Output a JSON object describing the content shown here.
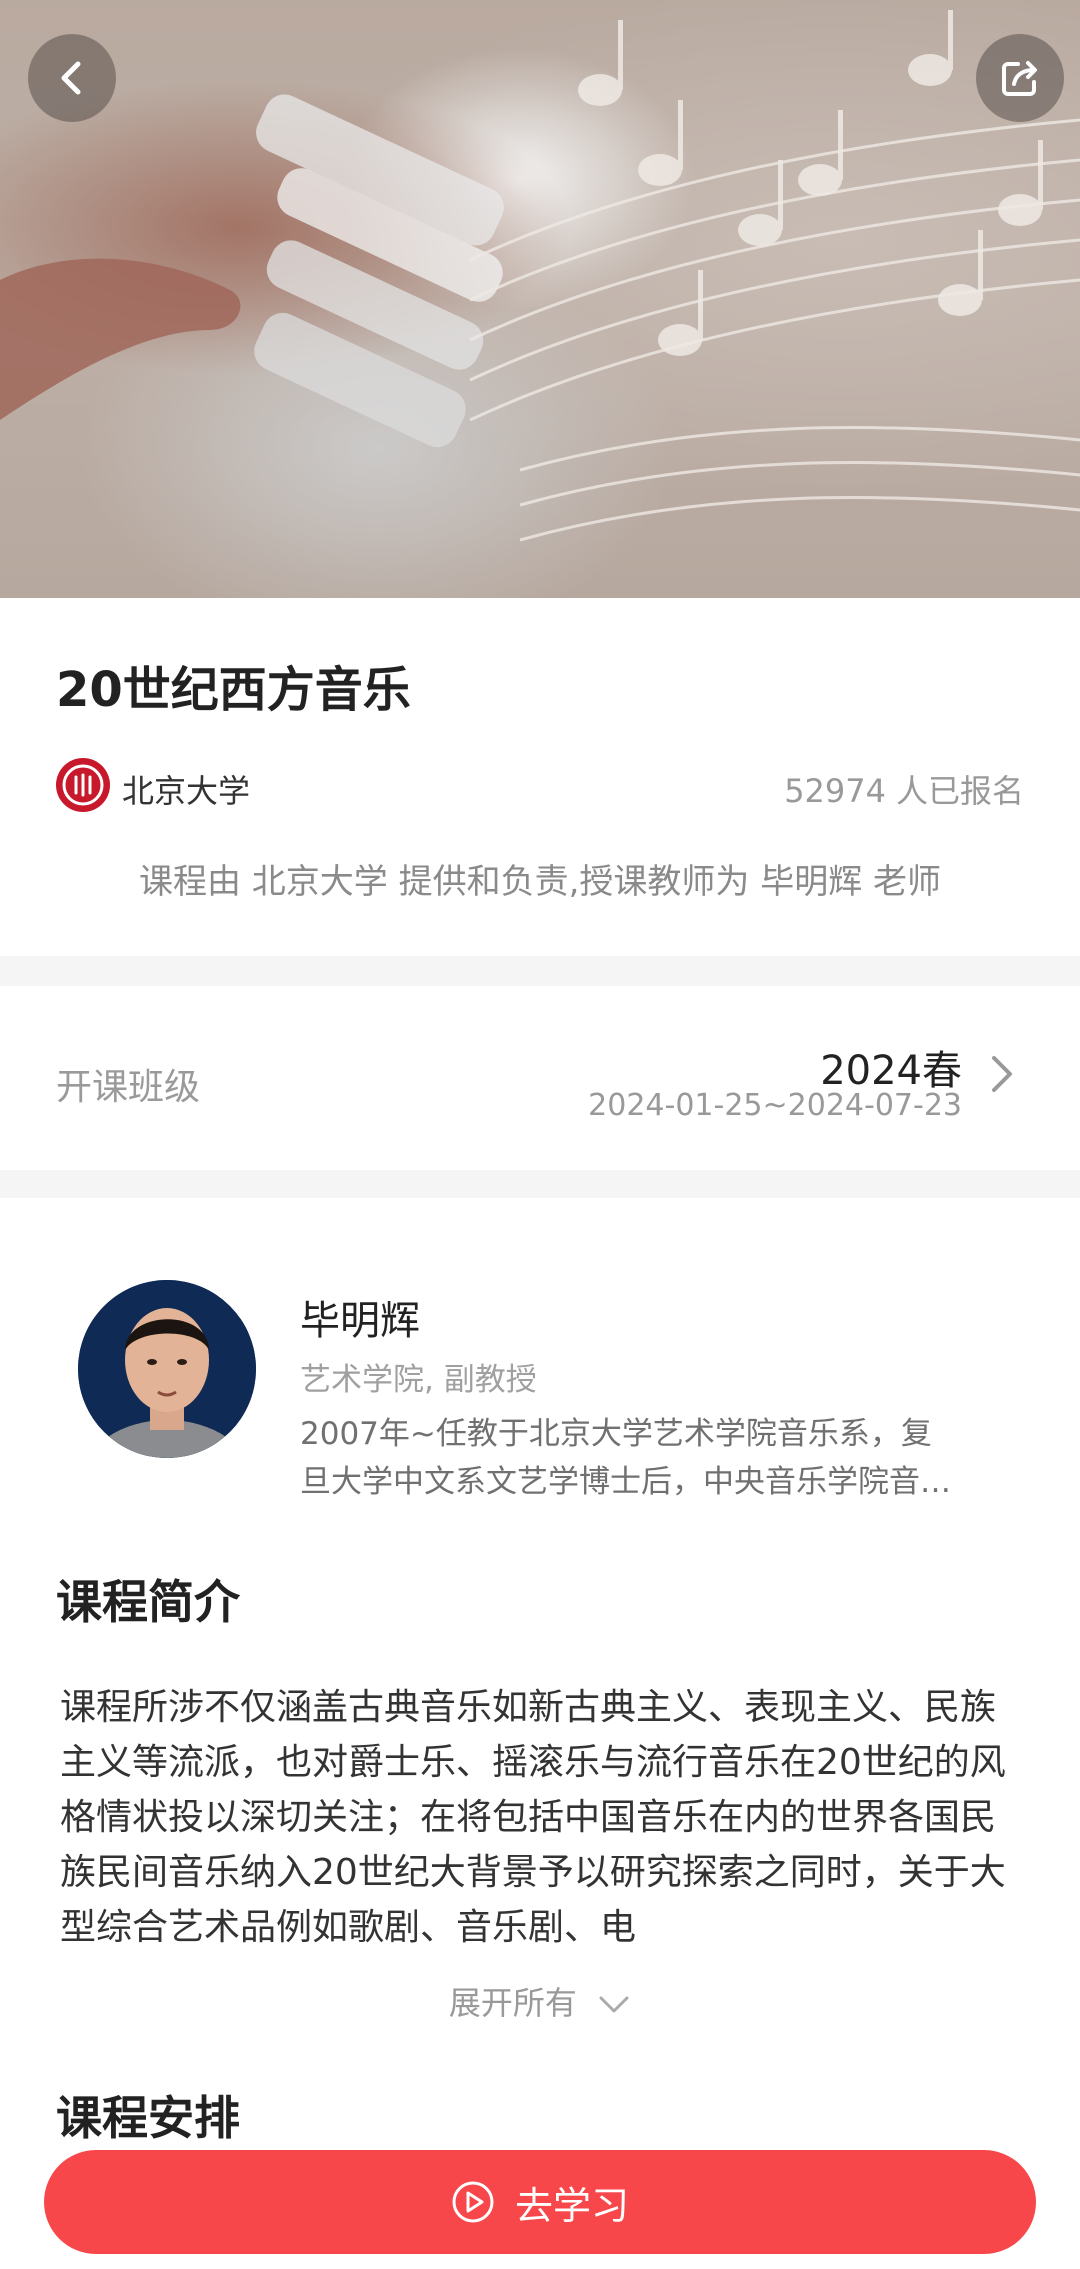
{
  "header": {
    "back_icon": "chevron-left-icon",
    "share_icon": "share-icon"
  },
  "course": {
    "title": "20世纪西方音乐",
    "university": "北京大学",
    "enrolled_count": "52974",
    "enrolled_suffix": "人已报名",
    "provider_line": "课程由 北京大学 提供和负责,授课教师为 毕明辉 老师"
  },
  "class_session": {
    "label": "开课班级",
    "name": "2024春",
    "dates": "2024-01-25~2024-07-23"
  },
  "teacher": {
    "name": "毕明辉",
    "title": "艺术学院, 副教授",
    "bio_line1": "2007年~任教于北京大学艺术学院音乐系，复",
    "bio_line2": "旦大学中文系文艺学博士后，中央音乐学院音乐学博士"
  },
  "intro": {
    "heading": "课程简介",
    "text": "课程所涉不仅涵盖古典音乐如新古典主义、表现主义、民族主义等流派，也对爵士乐、摇滚乐与流行音乐在20世纪的风格情状投以深切关注；在将包括中国音乐在内的世界各国民族民间音乐纳入20世纪大背景予以研究探索之同时，关于大型综合艺术品例如歌剧、音乐剧、电",
    "expand_label": "展开所有"
  },
  "schedule": {
    "heading": "课程安排"
  },
  "actions": {
    "study_label": "去学习"
  },
  "colors": {
    "accent": "#f7474b",
    "university_red": "#c7192b"
  }
}
